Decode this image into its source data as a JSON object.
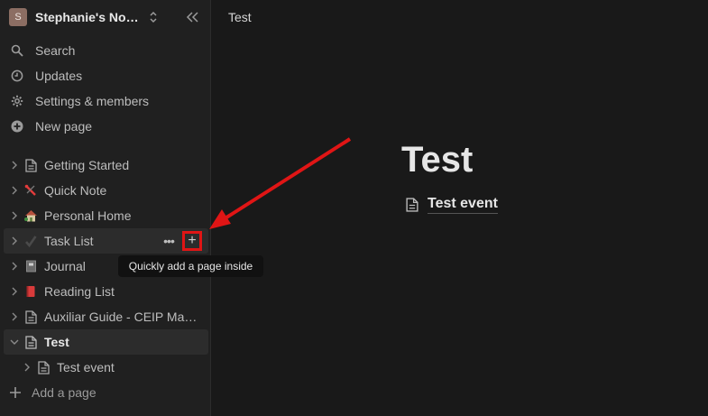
{
  "workspace": {
    "avatar_letter": "S",
    "name": "Stephanie's Notion",
    "switcher_icon": "chevron-up-down-icon",
    "collapse_icon": "double-chevron-left-icon"
  },
  "menu": [
    {
      "label": "Search",
      "icon": "search-icon"
    },
    {
      "label": "Updates",
      "icon": "clock-icon"
    },
    {
      "label": "Settings & members",
      "icon": "gear-icon"
    },
    {
      "label": "New page",
      "icon": "plus-circle-icon"
    }
  ],
  "pages": [
    {
      "label": "Getting Started",
      "icon": "page-icon"
    },
    {
      "label": "Quick Note",
      "icon": "pushpin-emoji"
    },
    {
      "label": "Personal Home",
      "icon": "house-emoji"
    },
    {
      "label": "Task List",
      "icon": "checkmark-emoji"
    },
    {
      "label": "Journal",
      "icon": "notebook-emoji"
    },
    {
      "label": "Reading List",
      "icon": "red-book-emoji"
    },
    {
      "label": "Auxiliar Guide - CEIP Manuel",
      "icon": "page-icon"
    },
    {
      "label": "Test",
      "icon": "page-icon"
    },
    {
      "label": "Test event",
      "icon": "page-icon"
    }
  ],
  "row_actions": {
    "more": "•••",
    "add": "+"
  },
  "add_page_label": "Add a page",
  "tooltip": "Quickly add a page inside",
  "breadcrumb": "Test",
  "main": {
    "title": "Test",
    "child_page": "Test event"
  },
  "colors": {
    "sidebar_bg": "#202020",
    "main_bg": "#191919",
    "highlight": "#e01515"
  }
}
